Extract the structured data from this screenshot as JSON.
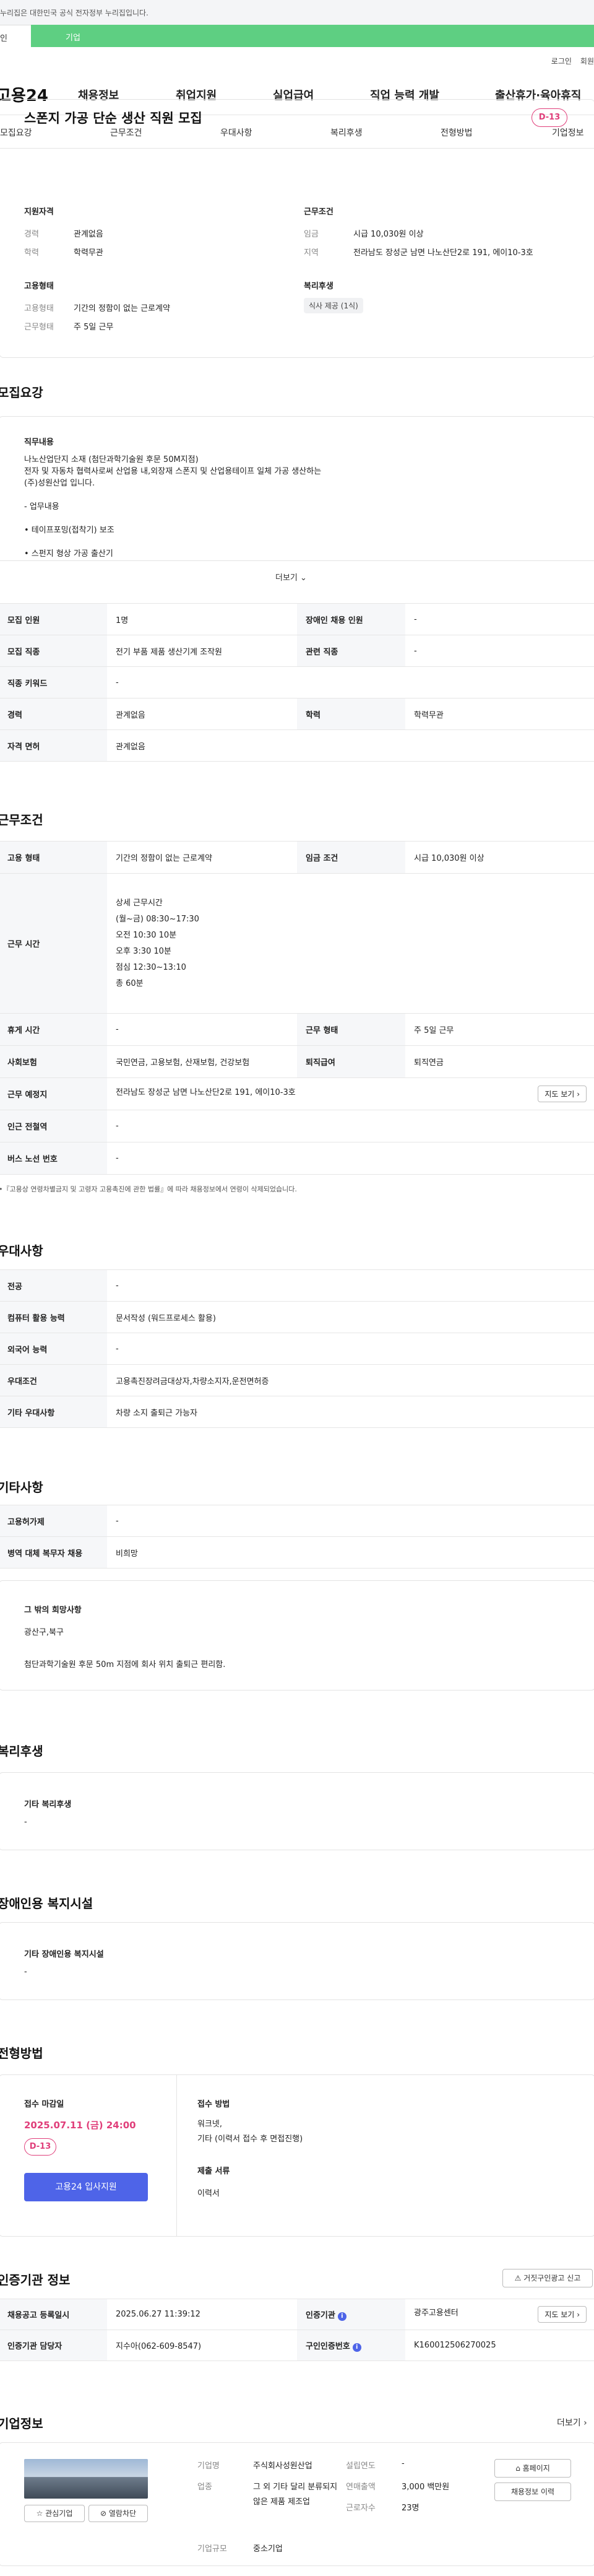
{
  "topbar": {
    "notice": "누리집은 대한민국 공식 전자정부 누리집입니다.",
    "tab_individual": "인",
    "tab_business": "기업"
  },
  "util": {
    "login": "로그인",
    "join": "회원"
  },
  "gnb": {
    "logo": "고용24",
    "items": [
      "채용정보",
      "취업지원",
      "실업급여",
      "직업 능력 개발",
      "출산휴가·육아휴직"
    ]
  },
  "snb": {
    "items": [
      "모집요강",
      "근무조건",
      "우대사항",
      "복리후생",
      "전형방법",
      "기업정보"
    ]
  },
  "summary": {
    "title": "스폰지 가공 단순 생산 직원 모집",
    "dday": "D-13",
    "qual_heading": "지원자격",
    "career_k": "경력",
    "career_v": "관계없음",
    "edu_k": "학력",
    "edu_v": "학력무관",
    "cond_heading": "근무조건",
    "wage_k": "임금",
    "wage_v": "시급 10,030원 이상",
    "loc_k": "지역",
    "loc_v": "전라남도 장성군 남면 나노산단2로 191, 에이10-3호",
    "emp_heading": "고용형태",
    "emptype_k": "고용형태",
    "emptype_v": "기간의 정함이 없는 근로계약",
    "worktype_k": "근무형태",
    "worktype_v": "주 5일 근무",
    "welfare_heading": "복리후생",
    "welfare_chip": "식사 제공 (1식)"
  },
  "recruit": {
    "heading": "모집요강",
    "job_heading": "직무내용",
    "lines": [
      "나노산업단지 소재 (첨단과학기술원 후문 50M지점)",
      "전자 및 자동차 협력사로써 산업용 내,외장재 스폰지 및 산업용테이프 일체 가공 생산하는",
      "(주)성원산업 입니다.",
      "- 업무내용",
      "• 테이프포밍(접착기) 보조",
      "• 스펀지 형상 가공 출산기"
    ],
    "more": "더보기",
    "rows": [
      [
        "모집 인원",
        "1명",
        "장애인 채용 인원",
        "-"
      ],
      [
        "모집 직종",
        "전기 부품 제품 생산기계 조작원",
        "관련 직종",
        "-"
      ],
      [
        "직종 키워드",
        "-"
      ],
      [
        "경력",
        "관계없음",
        "학력",
        "학력무관"
      ],
      [
        "자격 면허",
        "관계없음"
      ]
    ]
  },
  "conditions": {
    "heading": "근무조건",
    "emp_k": "고용 형태",
    "emp_v": "기간의 정함이 없는 근로계약",
    "wage_k": "임금 조건",
    "wage_v": "시급 10,030원 이상",
    "time_k": "근무 시간",
    "time_lines": [
      "상세 근무시간",
      "(월~금) 08:30~17:30",
      "오전 10:30  10분",
      "오후 3:30  10분",
      "점심 12:30~13:10",
      "총 60분"
    ],
    "rest_k": "휴게 시간",
    "rest_v": "-",
    "form_k": "근무 형태",
    "form_v": "주 5일 근무",
    "ins_k": "사회보험",
    "ins_v": "국민연금, 고용보험, 산재보험, 건강보험",
    "ret_k": "퇴직급여",
    "ret_v": "퇴직연금",
    "place_k": "근무 예정지",
    "place_v": "전라남도 장성군 남면 나노산단2로 191, 에이10-3호",
    "map_btn": "지도 보기",
    "station_k": "인근 전철역",
    "station_v": "-",
    "bus_k": "버스 노선 번호",
    "bus_v": "-",
    "note": "•『고용상 연령차별금지 및 고령자 고용촉진에 관한 법률』에 따라 채용정보에서 연령이 삭제되었습니다."
  },
  "prefer": {
    "heading": "우대사항",
    "rows": [
      [
        "전공",
        "-"
      ],
      [
        "컴퓨터 활용 능력",
        "문서작성 (워드프로세스 활용)"
      ],
      [
        "외국어 능력",
        "-"
      ],
      [
        "우대조건",
        "고용촉진장려금대상자,차량소지자,운전면허증"
      ],
      [
        "기타 우대사항",
        "차량 소지 출퇴근 가능자"
      ]
    ]
  },
  "other": {
    "heading": "기타사항",
    "rows": [
      [
        "고용허가제",
        "-"
      ],
      [
        "병역 대체 복무자 채용",
        "비희망"
      ]
    ],
    "box_title": "그 밖의 희망사항",
    "box_line1": "광산구,북구",
    "box_line2": "첨단과학기술원 후문 50m 지점에 회사 위치 출퇴근 편리함."
  },
  "welfare": {
    "heading": "복리후생",
    "box_title": "기타 복리후생",
    "box_value": "-"
  },
  "disabled": {
    "heading": "장애인용 복지시설",
    "box_title": "기타 장애인용 복지시설",
    "box_value": "-"
  },
  "process": {
    "heading": "전형방법",
    "deadline_k": "접수 마감일",
    "deadline_v": "2025.07.11 (금) 24:00",
    "dday": "D-13",
    "apply_btn": "고용24 입사지원",
    "method_k": "접수 방법",
    "method_v1": "워크넷,",
    "method_v2": "기타 (이력서 접수 후   면접진행)",
    "docs_k": "제출 서류",
    "docs_v": "이력서"
  },
  "cert": {
    "heading": "인증기관 정보",
    "report_btn": "거짓구인광고 신고",
    "reg_k": "채용공고 등록일시",
    "reg_v": "2025.06.27 11:39:12",
    "org_k": "인증기관",
    "org_v": "광주고용센터",
    "map_btn": "지도 보기",
    "mgr_k": "인증기관 담당자",
    "mgr_v": "지수아(062-609-8547)",
    "no_k": "구인인증번호",
    "no_v": "K160012506270025"
  },
  "company": {
    "heading": "기업정보",
    "more": "더보기",
    "fav_btn": "관심기업",
    "block_btn": "열람차단",
    "name_k": "기업명",
    "name_v": "주식회사성원산업",
    "est_k": "설립연도",
    "est_v": "-",
    "ind_k": "업종",
    "ind_v": "그 외 기타 달리 분류되지 않은 제품 제조업",
    "sales_k": "연매출액",
    "sales_v": "3,000 백만원",
    "emp_k": "근로자수",
    "emp_v": "23명",
    "size_k": "기업규모",
    "size_v": "중소기업",
    "home_btn": "홈페이지",
    "jobs_btn": "채용정보 이력"
  },
  "colors": {
    "accent": "#4e64e8",
    "dday": "#e03e7a",
    "green": "#5ecf82"
  }
}
